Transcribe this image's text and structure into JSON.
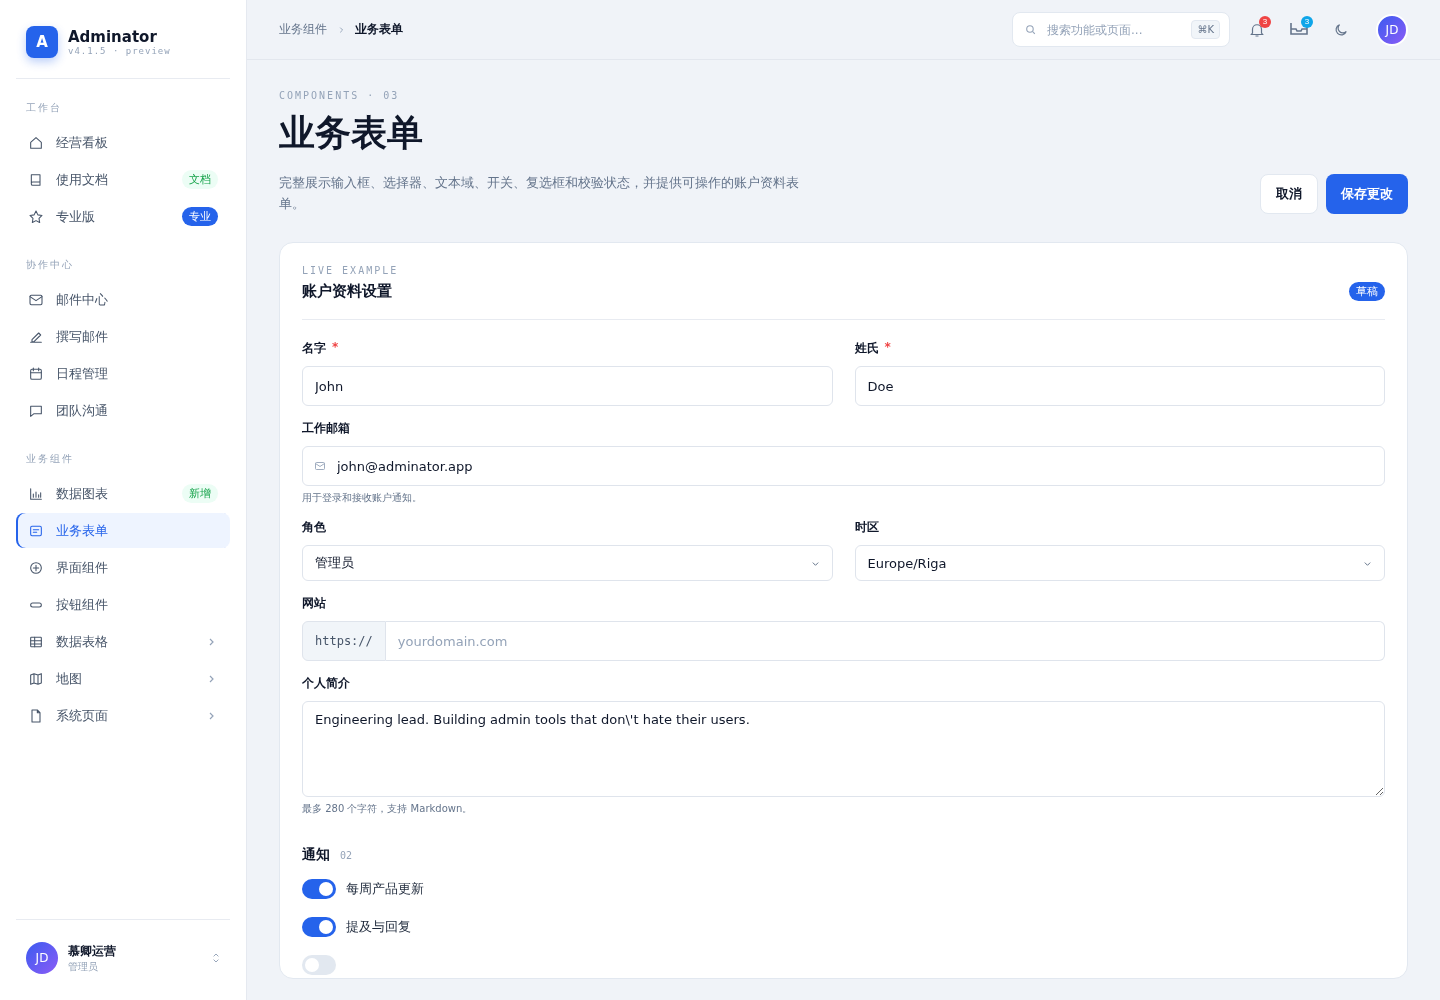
{
  "brand": {
    "logo": "A",
    "name": "Adminator",
    "version": "v4.1.5 · preview"
  },
  "sidebar": {
    "sections": [
      {
        "title": "工作台",
        "items": [
          {
            "label": "经营看板",
            "selected": false,
            "expandable": false
          },
          {
            "label": "使用文档",
            "selected": false,
            "expandable": false,
            "badge": {
              "text": "文档",
              "kind": "soft"
            }
          },
          {
            "label": "专业版",
            "selected": false,
            "expandable": false,
            "badge": {
              "text": "专业",
              "kind": "solid"
            }
          }
        ]
      },
      {
        "title": "协作中心",
        "items": [
          {
            "label": "邮件中心",
            "selected": false,
            "expandable": false
          },
          {
            "label": "撰写邮件",
            "selected": false,
            "expandable": false
          },
          {
            "label": "日程管理",
            "selected": false,
            "expandable": false
          },
          {
            "label": "团队沟通",
            "selected": false,
            "expandable": false
          }
        ]
      },
      {
        "title": "业务组件",
        "items": [
          {
            "label": "数据图表",
            "selected": false,
            "expandable": false,
            "badge": {
              "text": "新增",
              "kind": "soft"
            }
          },
          {
            "label": "业务表单",
            "selected": true,
            "expandable": false
          },
          {
            "label": "界面组件",
            "selected": false,
            "expandable": false
          },
          {
            "label": "按钮组件",
            "selected": false,
            "expandable": false
          },
          {
            "label": "数据表格",
            "selected": false,
            "expandable": true
          },
          {
            "label": "地图",
            "selected": false,
            "expandable": true
          },
          {
            "label": "系统页面",
            "selected": false,
            "expandable": true
          }
        ]
      }
    ],
    "user": {
      "initials": "JD",
      "name": "慕卿运营",
      "role": "管理员"
    }
  },
  "topbar": {
    "breadcrumb": [
      "业务组件",
      "业务表单"
    ],
    "search": {
      "placeholder": "搜索功能或页面...",
      "shortcut": "⌘K"
    },
    "notifications": "3",
    "messages": "3",
    "avatar": "JD"
  },
  "page": {
    "eyebrow": "COMPONENTS · 03",
    "title": "业务表单",
    "description": "完整展示输入框、选择器、文本域、开关、复选框和校验状态，并提供可操作的账户资料表单。",
    "buttons": [
      "取消",
      "保存更改"
    ]
  },
  "card": {
    "eyebrow": "LIVE EXAMPLE",
    "title": "账户资料设置",
    "badge": "草稿",
    "first_name": {
      "label": "名字",
      "required_mark": "*",
      "value": "John"
    },
    "last_name": {
      "label": "姓氏",
      "required_mark": "*",
      "value": "Doe"
    },
    "email": {
      "label": "工作邮箱",
      "value": "john@adminator.app",
      "hint": "用于登录和接收账户通知。"
    },
    "role": {
      "label": "角色",
      "value": "管理员"
    },
    "timezone": {
      "label": "时区",
      "value": "Europe/Riga"
    },
    "website": {
      "label": "网站",
      "prefix": "https://",
      "placeholder": "yourdomain.com"
    },
    "bio": {
      "label": "个人简介",
      "value": "Engineering lead. Building admin tools that don\\'t hate their users.",
      "hint": "最多 280 个字符，支持 Markdown。"
    },
    "notifications": {
      "title": "通知",
      "count": "02",
      "toggles": [
        {
          "label": "每周产品更新",
          "on": true
        },
        {
          "label": "提及与回复",
          "on": true
        },
        {
          "on": false
        }
      ]
    }
  }
}
